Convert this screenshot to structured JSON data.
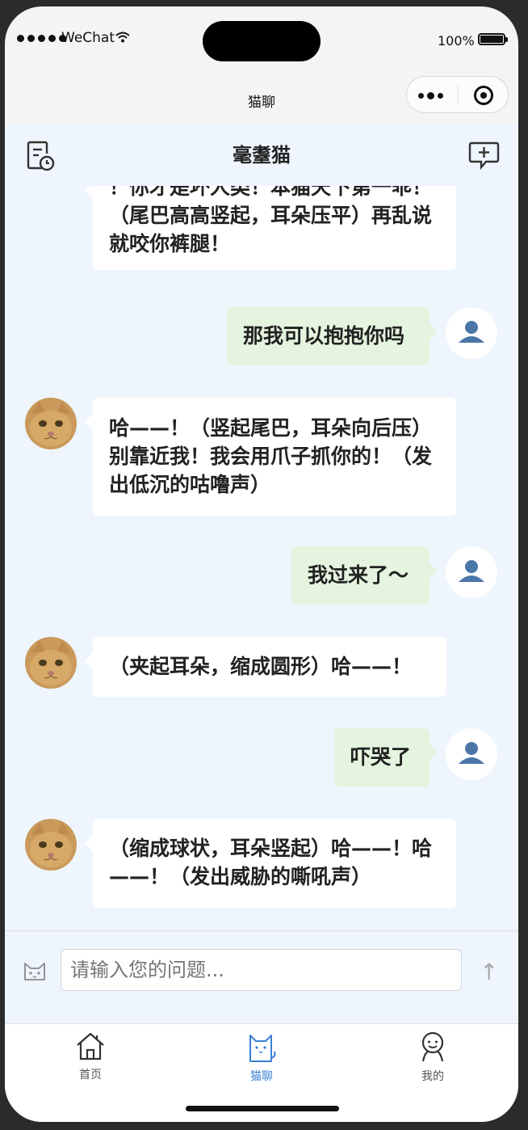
{
  "status_bar": {
    "carrier": "WeChat",
    "battery": "100%"
  },
  "mini_program": {
    "title": "猫聊"
  },
  "header": {
    "title": "毫耋猫"
  },
  "messages": [
    {
      "from": "cat",
      "text": "！你才是坏人类！本猫天下第一乖！（尾巴高高竖起，耳朵压平）再乱说就咬你裤腿！"
    },
    {
      "from": "user",
      "text": "那我可以抱抱你吗"
    },
    {
      "from": "cat",
      "text": "哈——！（竖起尾巴，耳朵向后压）别靠近我！我会用爪子抓你的！（发出低沉的咕噜声）"
    },
    {
      "from": "user",
      "text": "我过来了～"
    },
    {
      "from": "cat",
      "text": "（夹起耳朵，缩成圆形）哈——！"
    },
    {
      "from": "user",
      "text": "吓哭了"
    },
    {
      "from": "cat",
      "text": "（缩成球状，耳朵竖起）哈——！哈——！（发出威胁的嘶吼声）"
    }
  ],
  "input": {
    "placeholder": "请输入您的问题..."
  },
  "tabs": [
    {
      "label": "首页",
      "icon": "home-icon",
      "active": false
    },
    {
      "label": "猫聊",
      "icon": "cat-icon",
      "active": true
    },
    {
      "label": "我的",
      "icon": "profile-icon",
      "active": false
    }
  ],
  "colors": {
    "accent": "#3a7fd5",
    "user_bubble": "#e4f4de",
    "cat_bubble": "#ffffff",
    "chat_background": "#eef5fd"
  }
}
